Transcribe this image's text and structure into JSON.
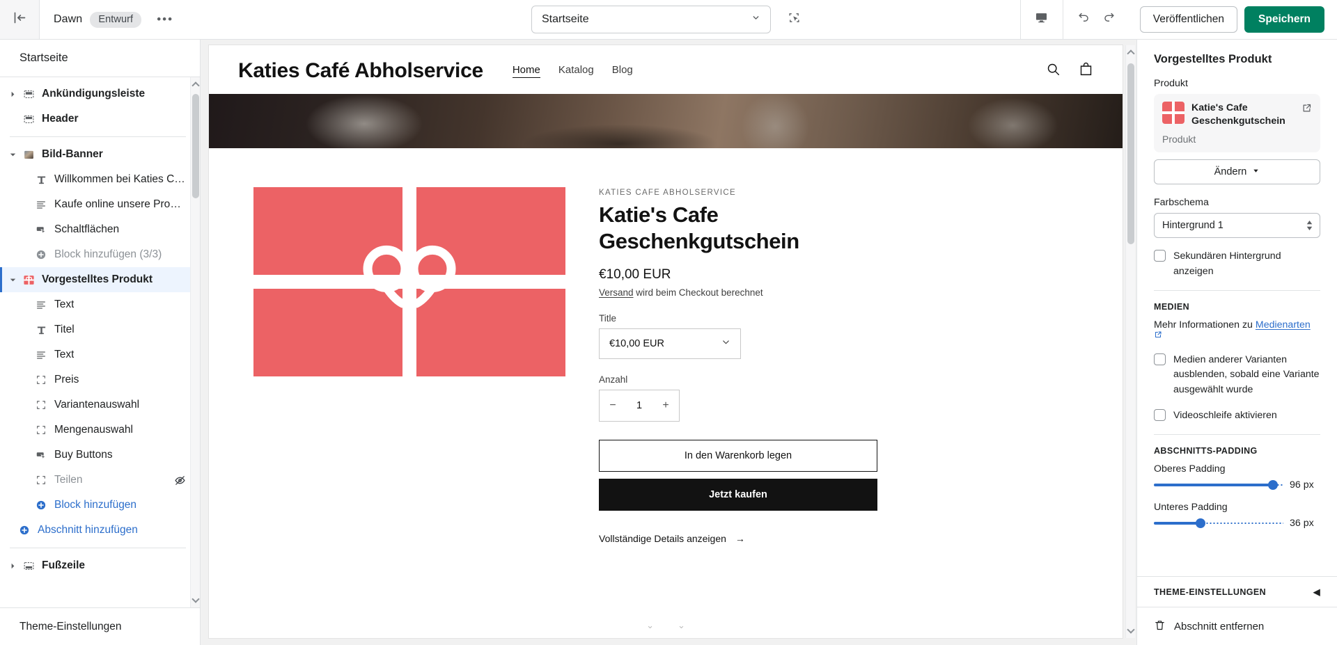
{
  "topbar": {
    "exit_icon": "exit-arrow-icon",
    "theme_name": "Dawn",
    "status_badge": "Entwurf",
    "more_label": "•••",
    "page_selector_value": "Startseite",
    "select_tool_icon": "marquee-select-icon",
    "device_icon": "desktop-icon",
    "undo_icon": "undo-icon",
    "redo_icon": "redo-icon",
    "publish_label": "Veröffentlichen",
    "save_label": "Speichern",
    "accent_green": "#008060"
  },
  "sidebar": {
    "header_title": "Startseite",
    "footer_label": "Theme-Einstellungen",
    "sections": [
      {
        "label": "Ankündigungsleiste",
        "icon": "section-bar-icon",
        "type": "section",
        "caret": "right",
        "selected": false,
        "dim": false
      },
      {
        "label": "Header",
        "icon": "header-icon",
        "type": "section",
        "caret": "none",
        "selected": false,
        "dim": false
      },
      {
        "label": "Bild-Banner",
        "icon": "image-thumb-icon",
        "type": "section",
        "caret": "down",
        "selected": false,
        "dim": false
      },
      {
        "label": "Willkommen bei Katies Café ...",
        "icon": "heading-text-icon",
        "type": "block",
        "selected": false,
        "dim": false
      },
      {
        "label": "Kaufe online unsere Produkte...",
        "icon": "paragraph-icon",
        "type": "block",
        "selected": false,
        "dim": false
      },
      {
        "label": "Schaltflächen",
        "icon": "button-cursor-icon",
        "type": "block",
        "selected": false,
        "dim": false
      },
      {
        "label": "Block hinzufügen (3/3)",
        "icon": "plus-circle-icon",
        "type": "block",
        "selected": false,
        "dim": true
      },
      {
        "label": "Vorgestelltes Produkt",
        "icon": "gift-product-icon",
        "type": "section",
        "caret": "down",
        "selected": true,
        "dim": false
      },
      {
        "label": "Text",
        "icon": "paragraph-icon",
        "type": "block",
        "selected": false,
        "dim": false
      },
      {
        "label": "Titel",
        "icon": "heading-text-icon",
        "type": "block",
        "selected": false,
        "dim": false
      },
      {
        "label": "Text",
        "icon": "paragraph-icon",
        "type": "block",
        "selected": false,
        "dim": false
      },
      {
        "label": "Preis",
        "icon": "placeholder-brackets-icon",
        "type": "block",
        "selected": false,
        "dim": false
      },
      {
        "label": "Variantenauswahl",
        "icon": "placeholder-brackets-icon",
        "type": "block",
        "selected": false,
        "dim": false
      },
      {
        "label": "Mengenauswahl",
        "icon": "placeholder-brackets-icon",
        "type": "block",
        "selected": false,
        "dim": false
      },
      {
        "label": "Buy Buttons",
        "icon": "button-cursor-icon",
        "type": "block",
        "selected": false,
        "dim": false
      },
      {
        "label": "Teilen",
        "icon": "placeholder-brackets-icon",
        "type": "block",
        "selected": false,
        "dim": true,
        "hidden_icon": "eye-off-icon"
      }
    ],
    "add_block_label": "Block hinzufügen",
    "add_section_label": "Abschnitt hinzufügen",
    "footer_section": {
      "label": "Fußzeile",
      "icon": "footer-icon",
      "caret": "right"
    }
  },
  "preview": {
    "store_name": "Katies Café Abholservice",
    "nav": [
      {
        "label": "Home",
        "active": true
      },
      {
        "label": "Katalog",
        "active": false
      },
      {
        "label": "Blog",
        "active": false
      }
    ],
    "search_icon": "search-icon",
    "cart_icon": "shopping-bag-icon",
    "product": {
      "vendor": "KATIES CAFE ABHOLSERVICE",
      "title": "Katie's Cafe Geschenkgutschein",
      "price": "€10,00 EUR",
      "shipping_link": "Versand",
      "shipping_rest": " wird beim Checkout berechnet",
      "variant_label": "Title",
      "variant_value": "€10,00 EUR",
      "quantity_label": "Anzahl",
      "quantity_minus": "−",
      "quantity_value": "1",
      "quantity_plus": "+",
      "add_to_cart_label": "In den Warenkorb legen",
      "buy_now_label": "Jetzt kaufen",
      "details_label": "Vollständige Details anzeigen",
      "details_arrow": "→",
      "media_color": "#ec6265"
    }
  },
  "rightpanel": {
    "title": "Vorgestelltes Produkt",
    "product_field_label": "Produkt",
    "product_name": "Katie's Cafe Geschenkgutschein",
    "product_type": "Produkt",
    "external_icon": "external-link-icon",
    "change_label": "Ändern",
    "color_scheme_label": "Farbschema",
    "color_scheme_value": "Hintergrund 1",
    "secondary_bg_label": "Sekundären Hintergrund anzeigen",
    "secondary_bg_checked": false,
    "media_title": "MEDIEN",
    "media_note_prefix": "Mehr Informationen zu ",
    "media_note_link": "Medienarten",
    "hide_variant_media_label": "Medien anderer Varianten ausblenden, sobald eine Variante ausgewählt wurde",
    "hide_variant_media_checked": false,
    "video_loop_label": "Videoschleife aktivieren",
    "video_loop_checked": false,
    "padding_title": "ABSCHNITTS-PADDING",
    "top_padding_label": "Oberes Padding",
    "top_padding_value": "96 px",
    "top_padding_percent": 92,
    "bottom_padding_label": "Unteres Padding",
    "bottom_padding_value": "36 px",
    "bottom_padding_percent": 36,
    "theme_settings_label": "THEME-EINSTELLUNGEN",
    "theme_settings_caret": "◀",
    "remove_section_label": "Abschnitt entfernen",
    "remove_icon": "trash-icon",
    "accent_blue": "#2c6ecb"
  }
}
